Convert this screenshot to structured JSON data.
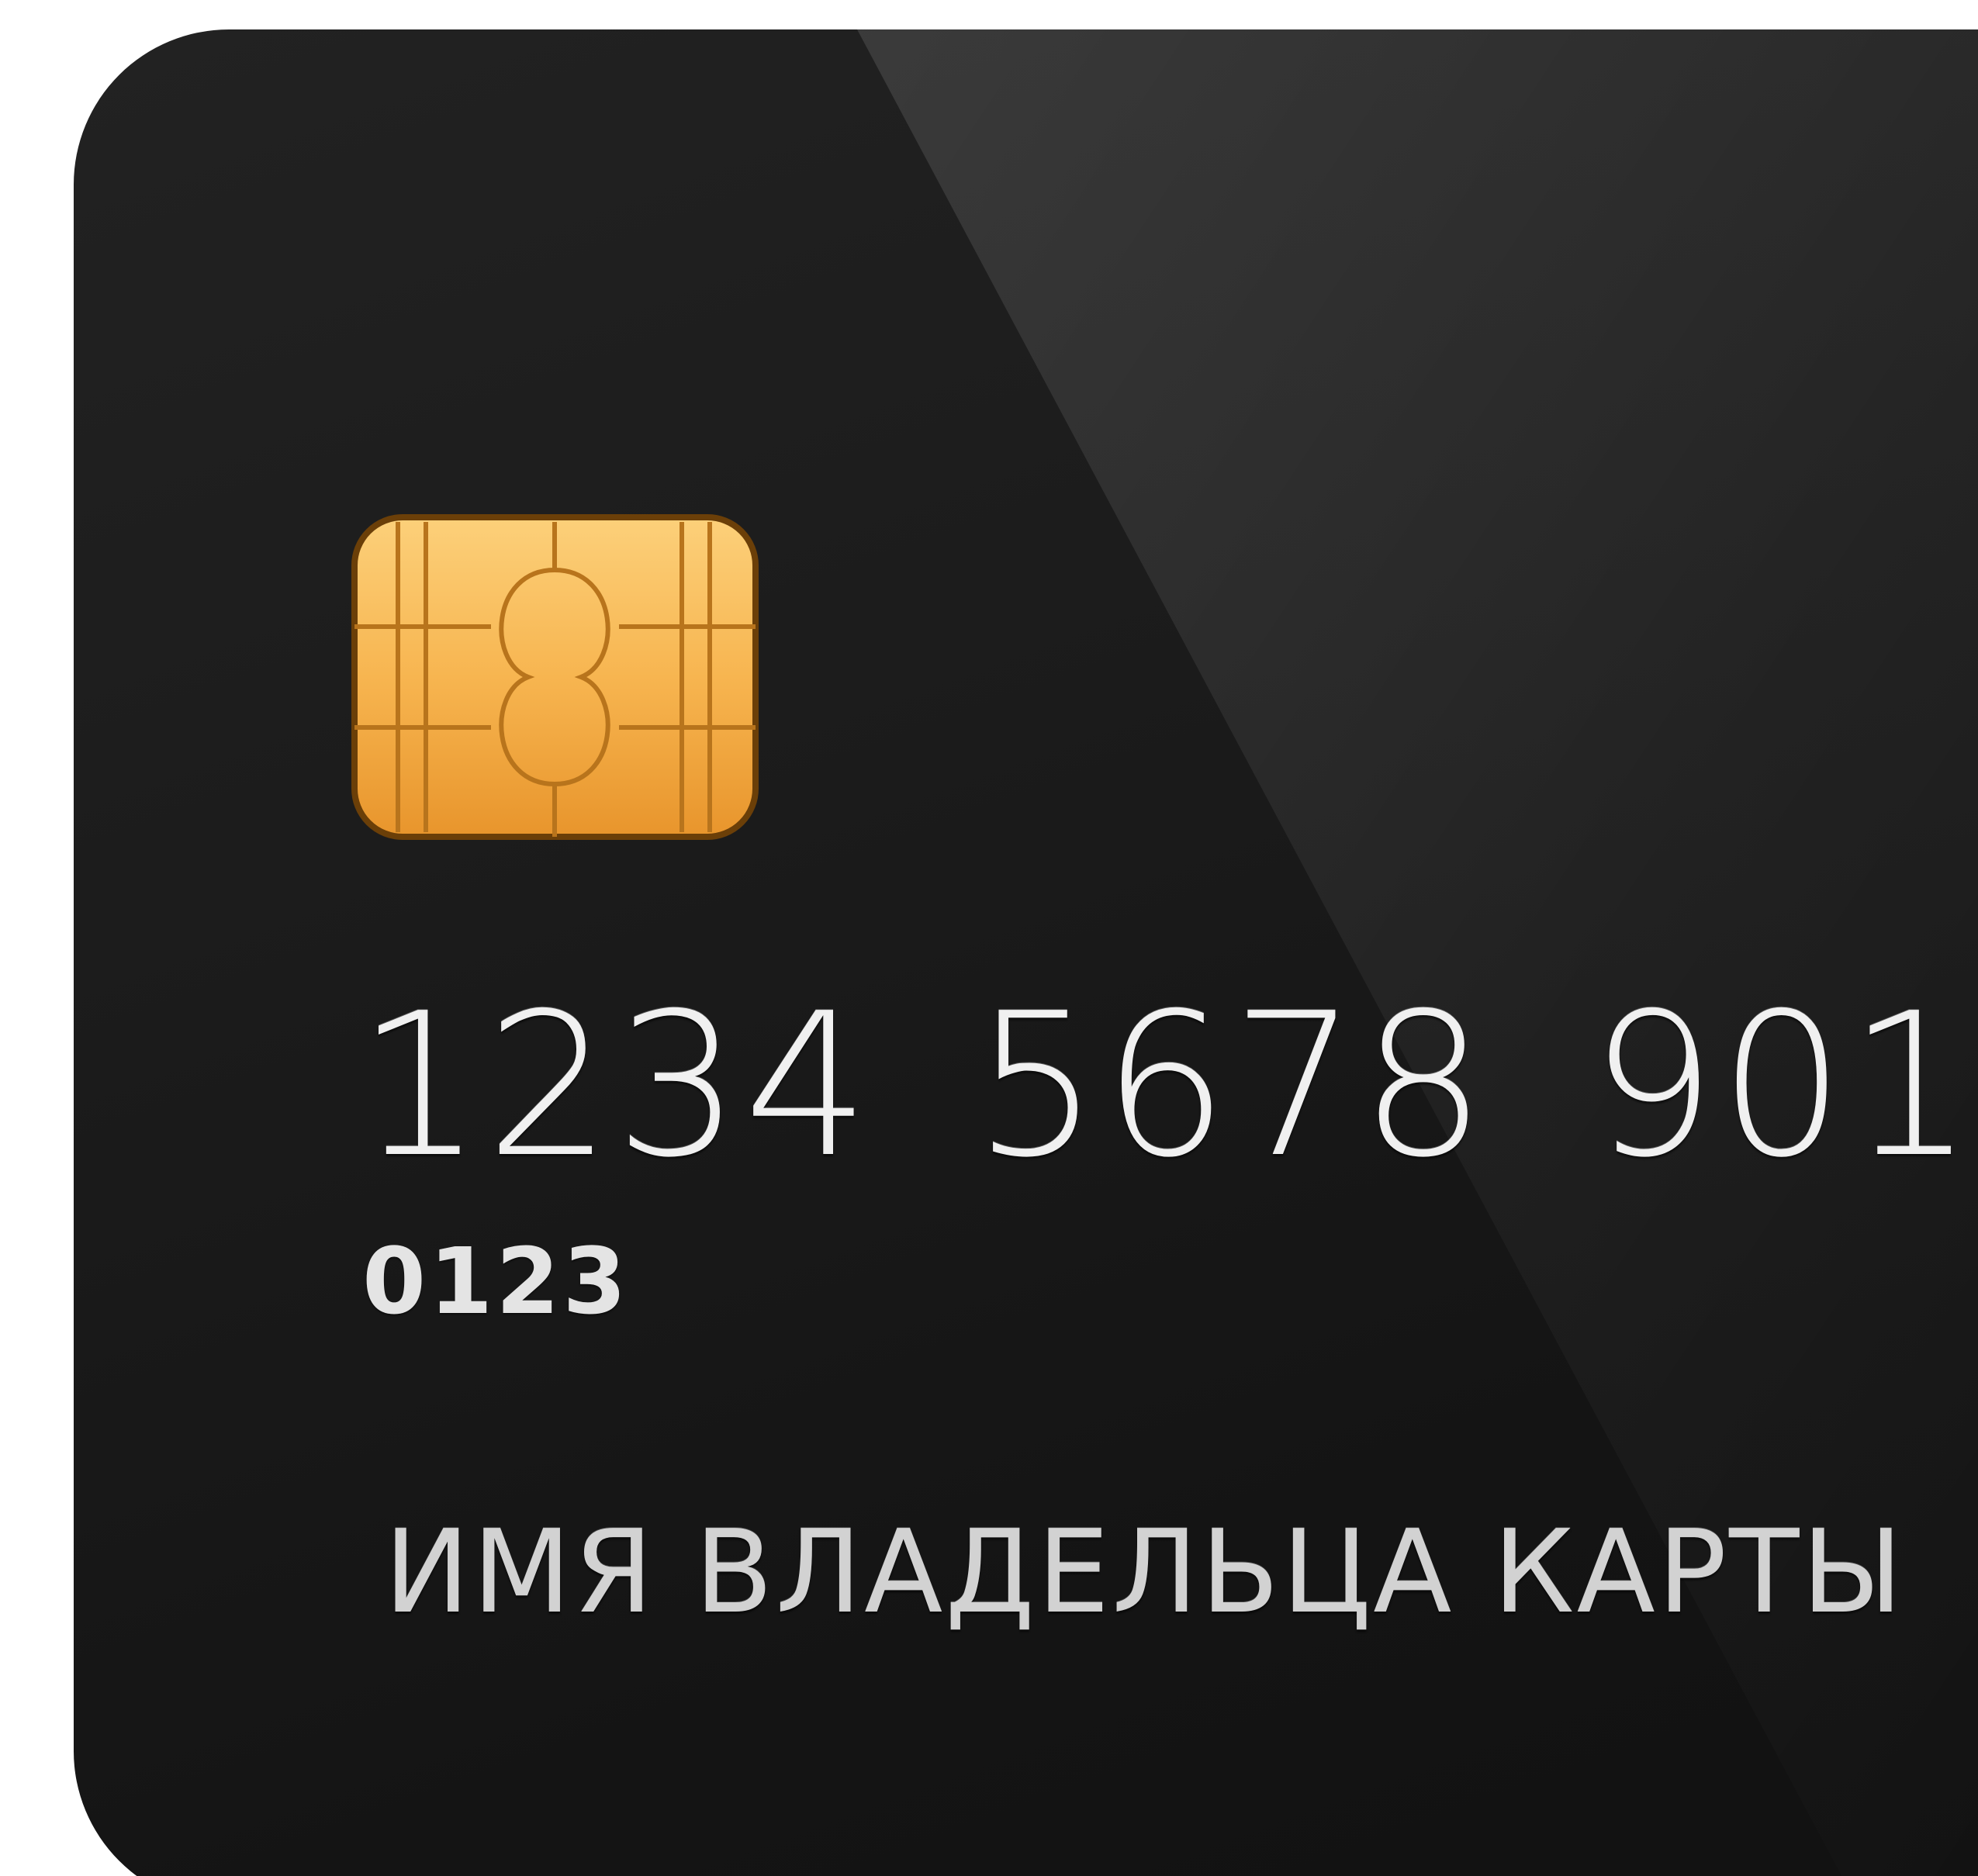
{
  "card": {
    "number_groups": [
      "1234",
      "5678",
      "901"
    ],
    "sub_number": "0123",
    "holder_name": "ИМЯ ВЛАДЕЛЬЦА КАРТЫ"
  },
  "icons": {
    "chip": "emv-chip-icon"
  },
  "colors": {
    "card_background": "#1b1b1b",
    "chip_gold": "#f7b550",
    "text": "#f0f0f0"
  }
}
